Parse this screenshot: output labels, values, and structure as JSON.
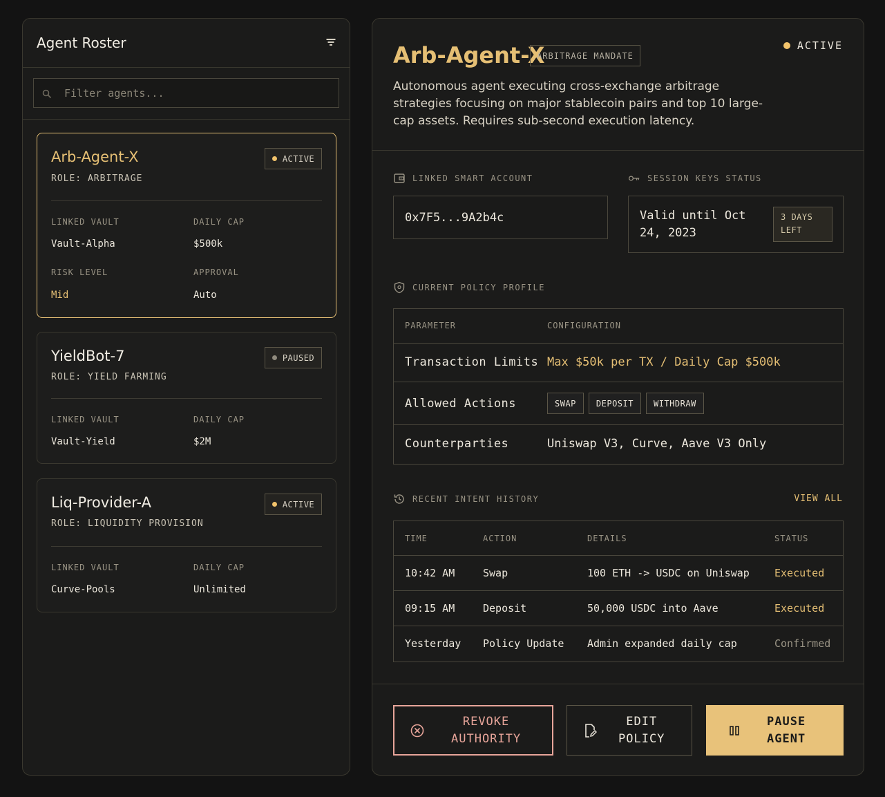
{
  "roster": {
    "title": "Agent Roster",
    "search_placeholder": "Filter agents...",
    "agents": [
      {
        "name": "Arb-Agent-X",
        "role": "ROLE: ARBITRAGE",
        "status": "ACTIVE",
        "fields": [
          {
            "label": "LINKED VAULT",
            "value": "Vault-Alpha"
          },
          {
            "label": "DAILY CAP",
            "value": "$500k"
          },
          {
            "label": "RISK LEVEL",
            "value": "Mid"
          },
          {
            "label": "APPROVAL",
            "value": "Auto"
          }
        ]
      },
      {
        "name": "YieldBot-7",
        "role": "ROLE: YIELD FARMING",
        "status": "PAUSED",
        "fields": [
          {
            "label": "LINKED VAULT",
            "value": "Vault-Yield"
          },
          {
            "label": "DAILY CAP",
            "value": "$2M"
          }
        ]
      },
      {
        "name": "Liq-Provider-A",
        "role": "ROLE: LIQUIDITY PROVISION",
        "status": "ACTIVE",
        "fields": [
          {
            "label": "LINKED VAULT",
            "value": "Curve-Pools"
          },
          {
            "label": "DAILY CAP",
            "value": "Unlimited"
          }
        ]
      }
    ]
  },
  "detail": {
    "name": "Arb-Agent-X",
    "mandate": "ARBITRAGE MANDATE",
    "status": "ACTIVE",
    "description": "Autonomous agent executing cross-exchange arbitrage strategies focusing on major stablecoin pairs and top 10 large-cap assets. Requires sub-second execution latency.",
    "linked_account_label": "LINKED SMART ACCOUNT",
    "linked_account": "0x7F5...9A2b4c",
    "session_label": "SESSION KEYS STATUS",
    "session_value": "Valid until Oct 24, 2023",
    "session_badge": "3 DAYS LEFT",
    "policy_label": "CURRENT POLICY PROFILE",
    "policy_headers": [
      "PARAMETER",
      "CONFIGURATION"
    ],
    "policy_rows": {
      "limits_key": "Transaction Limits",
      "limits_value": "Max $50k per TX / Daily Cap $500k",
      "actions_key": "Allowed Actions",
      "actions": [
        "SWAP",
        "DEPOSIT",
        "WITHDRAW"
      ],
      "counterparties_key": "Counterparties",
      "counterparties_value": "Uniswap V3, Curve, Aave V3 Only"
    },
    "history_label": "RECENT INTENT HISTORY",
    "view_all": "VIEW ALL",
    "history_headers": [
      "TIME",
      "ACTION",
      "DETAILS",
      "STATUS"
    ],
    "history": [
      {
        "time": "10:42 AM",
        "action": "Swap",
        "details": "100 ETH -> USDC on Uniswap",
        "status": "Executed"
      },
      {
        "time": "09:15 AM",
        "action": "Deposit",
        "details": "50,000 USDC into Aave",
        "status": "Executed"
      },
      {
        "time": "Yesterday",
        "action": "Policy Update",
        "details": "Admin expanded daily cap",
        "status": "Confirmed"
      }
    ],
    "buttons": {
      "revoke_1": "REVOKE",
      "revoke_2": "AUTHORITY",
      "edit_1": "EDIT",
      "edit_2": "POLICY",
      "pause_1": "PAUSE",
      "pause_2": "AGENT"
    }
  },
  "colors": {
    "accent": "#e5bf74",
    "danger": "#e8a59a",
    "background": "#131313",
    "panel": "#1b1b1a"
  }
}
